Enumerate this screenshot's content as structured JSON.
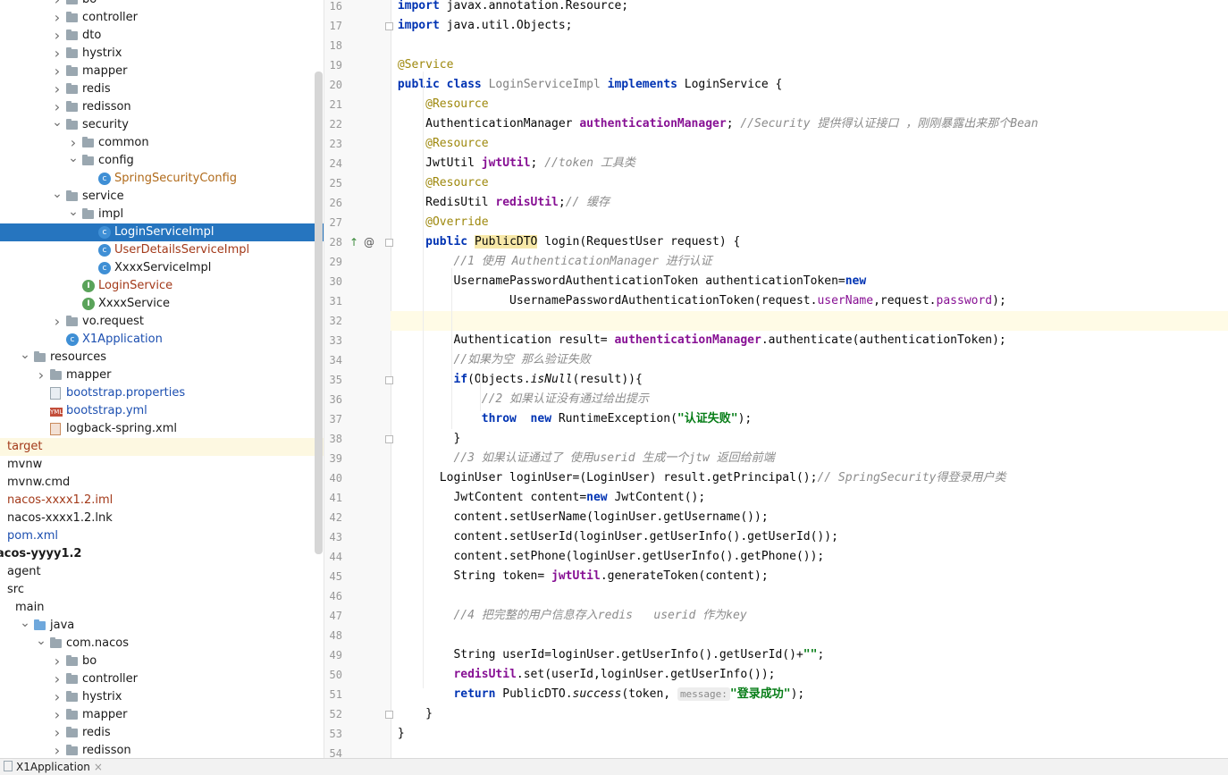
{
  "tree": {
    "items": [
      {
        "label": "bo",
        "depth": 3,
        "arrow": "right",
        "icon": "folder",
        "color": "norm"
      },
      {
        "label": "controller",
        "depth": 3,
        "arrow": "right",
        "icon": "folder",
        "color": "norm"
      },
      {
        "label": "dto",
        "depth": 3,
        "arrow": "right",
        "icon": "folder",
        "color": "norm"
      },
      {
        "label": "hystrix",
        "depth": 3,
        "arrow": "right",
        "icon": "folder",
        "color": "norm"
      },
      {
        "label": "mapper",
        "depth": 3,
        "arrow": "right",
        "icon": "folder",
        "color": "norm"
      },
      {
        "label": "redis",
        "depth": 3,
        "arrow": "right",
        "icon": "folder",
        "color": "norm"
      },
      {
        "label": "redisson",
        "depth": 3,
        "arrow": "right",
        "icon": "folder",
        "color": "norm"
      },
      {
        "label": "security",
        "depth": 3,
        "arrow": "down",
        "icon": "folder",
        "color": "norm"
      },
      {
        "label": "common",
        "depth": 4,
        "arrow": "right",
        "icon": "folder",
        "color": "norm"
      },
      {
        "label": "config",
        "depth": 4,
        "arrow": "down",
        "icon": "folder",
        "color": "norm"
      },
      {
        "label": "SpringSecurityConfig",
        "depth": 5,
        "arrow": "",
        "icon": "class",
        "color": "orange"
      },
      {
        "label": "service",
        "depth": 3,
        "arrow": "down",
        "icon": "folder",
        "color": "norm"
      },
      {
        "label": "impl",
        "depth": 4,
        "arrow": "down",
        "icon": "folder",
        "color": "norm"
      },
      {
        "label": "LoginServiceImpl",
        "depth": 5,
        "arrow": "",
        "icon": "class",
        "color": "norm",
        "selected": true
      },
      {
        "label": "UserDetailsServiceImpl",
        "depth": 5,
        "arrow": "",
        "icon": "class",
        "color": "brown"
      },
      {
        "label": "XxxxServiceImpl",
        "depth": 5,
        "arrow": "",
        "icon": "class",
        "color": "norm"
      },
      {
        "label": "LoginService",
        "depth": 4,
        "arrow": "",
        "icon": "interface",
        "color": "brown"
      },
      {
        "label": "XxxxService",
        "depth": 4,
        "arrow": "",
        "icon": "interface",
        "color": "norm"
      },
      {
        "label": "vo.request",
        "depth": 3,
        "arrow": "right",
        "icon": "folder",
        "color": "norm"
      },
      {
        "label": "X1Application",
        "depth": 3,
        "arrow": "",
        "icon": "app",
        "color": "blue"
      },
      {
        "label": "resources",
        "depth": 1,
        "arrow": "down",
        "icon": "folder",
        "color": "norm"
      },
      {
        "label": "mapper",
        "depth": 2,
        "arrow": "right",
        "icon": "folder",
        "color": "norm"
      },
      {
        "label": "bootstrap.properties",
        "depth": 2,
        "arrow": "",
        "icon": "props",
        "color": "blue"
      },
      {
        "label": "bootstrap.yml",
        "depth": 2,
        "arrow": "",
        "icon": "yml",
        "color": "blue"
      },
      {
        "label": "logback-spring.xml",
        "depth": 2,
        "arrow": "",
        "icon": "xml",
        "color": "norm"
      },
      {
        "label": "target",
        "depth": 0,
        "arrow": "",
        "icon": "none",
        "color": "brown",
        "highlight": true
      },
      {
        "label": "mvnw",
        "depth": 0,
        "arrow": "",
        "icon": "none",
        "color": "norm"
      },
      {
        "label": "mvnw.cmd",
        "depth": 0,
        "arrow": "",
        "icon": "none",
        "color": "norm"
      },
      {
        "label": "nacos-xxxx1.2.iml",
        "depth": 0,
        "arrow": "",
        "icon": "none",
        "color": "brown"
      },
      {
        "label": "nacos-xxxx1.2.lnk",
        "depth": 0,
        "arrow": "",
        "icon": "none",
        "color": "norm"
      },
      {
        "label": "pom.xml",
        "depth": 0,
        "arrow": "",
        "icon": "none",
        "color": "blue"
      },
      {
        "label": "acos-yyyy1.2",
        "depth": -1,
        "arrow": "",
        "icon": "none",
        "color": "norm",
        "bold": true
      },
      {
        "label": "agent",
        "depth": 0,
        "arrow": "",
        "icon": "none",
        "color": "norm"
      },
      {
        "label": "src",
        "depth": 0,
        "arrow": "",
        "icon": "none",
        "color": "norm"
      },
      {
        "label": "main",
        "depth": 0.5,
        "arrow": "",
        "icon": "none",
        "color": "norm"
      },
      {
        "label": "java",
        "depth": 1,
        "arrow": "down",
        "icon": "bluefolder",
        "color": "norm"
      },
      {
        "label": "com.nacos",
        "depth": 2,
        "arrow": "down",
        "icon": "folder",
        "color": "norm"
      },
      {
        "label": "bo",
        "depth": 3,
        "arrow": "right",
        "icon": "folder",
        "color": "norm"
      },
      {
        "label": "controller",
        "depth": 3,
        "arrow": "right",
        "icon": "folder",
        "color": "norm"
      },
      {
        "label": "hystrix",
        "depth": 3,
        "arrow": "right",
        "icon": "folder",
        "color": "norm"
      },
      {
        "label": "mapper",
        "depth": 3,
        "arrow": "right",
        "icon": "folder",
        "color": "norm"
      },
      {
        "label": "redis",
        "depth": 3,
        "arrow": "right",
        "icon": "folder",
        "color": "norm"
      },
      {
        "label": "redisson",
        "depth": 3,
        "arrow": "right",
        "icon": "folder",
        "color": "norm"
      }
    ]
  },
  "editor": {
    "gutter_icons": {
      "line": "28",
      "implements": "↑",
      "override": "@"
    },
    "hint_label": "message:",
    "lines": [
      {
        "n": "16",
        "text": "import javax.annotation.Resource;"
      },
      {
        "n": "17",
        "text": "import java.util.Objects;"
      },
      {
        "n": "18",
        "text": ""
      },
      {
        "n": "19",
        "text": "@Service"
      },
      {
        "n": "20",
        "text": "public class LoginServiceImpl implements LoginService {"
      },
      {
        "n": "21",
        "text": "    @Resource"
      },
      {
        "n": "22",
        "text": "    AuthenticationManager authenticationManager; //Security 提供得认证接口 ，刚刚暴露出来那个Bean"
      },
      {
        "n": "23",
        "text": "    @Resource"
      },
      {
        "n": "24",
        "text": "    JwtUtil jwtUtil; //token 工具类"
      },
      {
        "n": "25",
        "text": "    @Resource"
      },
      {
        "n": "26",
        "text": "    RedisUtil redisUtil;// 缓存"
      },
      {
        "n": "27",
        "text": "    @Override"
      },
      {
        "n": "28",
        "text": "    public PublicDTO login(RequestUser request) {"
      },
      {
        "n": "29",
        "text": "        //1 使用 AuthenticationManager 进行认证"
      },
      {
        "n": "30",
        "text": "        UsernamePasswordAuthenticationToken authenticationToken=new"
      },
      {
        "n": "31",
        "text": "                UsernamePasswordAuthenticationToken(request.userName,request.password);"
      },
      {
        "n": "32",
        "text": ""
      },
      {
        "n": "33",
        "text": "        Authentication result= authenticationManager.authenticate(authenticationToken);"
      },
      {
        "n": "34",
        "text": "        //如果为空 那么验证失败"
      },
      {
        "n": "35",
        "text": "        if(Objects.isNull(result)){"
      },
      {
        "n": "36",
        "text": "            //2 如果认证没有通过给出提示"
      },
      {
        "n": "37",
        "text": "            throw  new RuntimeException(\"认证失败\");"
      },
      {
        "n": "38",
        "text": "        }"
      },
      {
        "n": "39",
        "text": "        //3 如果认证通过了 使用userid 生成一个jtw 返回给前端"
      },
      {
        "n": "40",
        "text": "      LoginUser loginUser=(LoginUser) result.getPrincipal();// SpringSecurity得登录用户类"
      },
      {
        "n": "41",
        "text": "        JwtContent content=new JwtContent();"
      },
      {
        "n": "42",
        "text": "        content.setUserName(loginUser.getUsername());"
      },
      {
        "n": "43",
        "text": "        content.setUserId(loginUser.getUserInfo().getUserId());"
      },
      {
        "n": "44",
        "text": "        content.setPhone(loginUser.getUserInfo().getPhone());"
      },
      {
        "n": "45",
        "text": "        String token= jwtUtil.generateToken(content);"
      },
      {
        "n": "46",
        "text": ""
      },
      {
        "n": "47",
        "text": "        //4 把完整的用户信息存入redis   userid 作为key"
      },
      {
        "n": "48",
        "text": ""
      },
      {
        "n": "49",
        "text": "        String userId=loginUser.getUserInfo().getUserId()+\"\";"
      },
      {
        "n": "50",
        "text": "        redisUtil.set(userId,loginUser.getUserInfo());"
      },
      {
        "n": "51",
        "text": "        return PublicDTO.success(token, \"登录成功\");"
      },
      {
        "n": "52",
        "text": "    }"
      },
      {
        "n": "53",
        "text": "}"
      },
      {
        "n": "54",
        "text": ""
      }
    ]
  },
  "bottom_tab": {
    "label": "X1Application",
    "close": "×"
  }
}
